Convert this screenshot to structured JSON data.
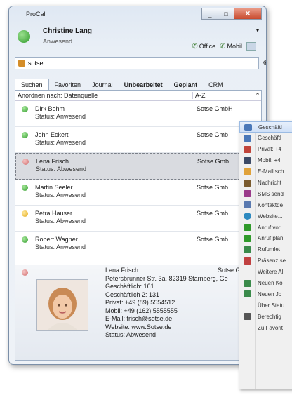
{
  "window": {
    "title": "ProCall",
    "controls": {
      "minimize": "_",
      "maximize": "□",
      "close": "✕"
    }
  },
  "user": {
    "name": "Christine Lang",
    "status": "Anwesend",
    "menu_glyph": "▾"
  },
  "modes": [
    {
      "label": "Office",
      "icon": "phone-icon"
    },
    {
      "label": "Mobil",
      "icon": "mobile-icon"
    }
  ],
  "search": {
    "value": "sotse",
    "button": "⊕"
  },
  "tabs": [
    {
      "label": "Suchen",
      "active": true
    },
    {
      "label": "Favoriten"
    },
    {
      "label": "Journal"
    },
    {
      "label": "Unbearbeitet",
      "bold": true
    },
    {
      "label": "Geplant",
      "bold": true
    },
    {
      "label": "CRM"
    }
  ],
  "sort": {
    "label": "Anordnen nach: Datenquelle",
    "value": "A-Z",
    "arrow": "⌃"
  },
  "contacts": [
    {
      "name": "Dirk Bohm",
      "status": "Status: Anwesend",
      "company": "Sotse GmbH",
      "dot": "green"
    },
    {
      "name": "John Eckert",
      "status": "Status: Anwesend",
      "company": "Sotse Gmb",
      "dot": "green"
    },
    {
      "name": "Lena Frisch",
      "status": "Status: Abwesend",
      "company": "Sotse Gmb",
      "dot": "pink",
      "selected": true
    },
    {
      "name": "Martin Seeler",
      "status": "Status: Anwesend",
      "company": "Sotse Gmb",
      "dot": "green"
    },
    {
      "name": "Petra Hauser",
      "status": "Status: Abwesend",
      "company": "Sotse Gmb",
      "dot": "yellow"
    },
    {
      "name": "Robert Wagner",
      "status": "Status: Anwesend",
      "company": "Sotse Gmb",
      "dot": "green"
    }
  ],
  "detail": {
    "name": "Lena Frisch",
    "company": "Sotse G",
    "lines": [
      "Petersbrunner Str. 3a, 82319 Starnberg, Ge",
      "Geschäftlich: 161",
      "Geschäftlich 2: 131",
      "Privat: +49 (89) 5554512",
      "Mobil: +49 (162) 5555555",
      "E-Mail: frisch@sotse.de",
      "Website: www.Sotse.de",
      "Status: Abwesend"
    ]
  },
  "context_menu": [
    {
      "label": "Geschäftl",
      "icon": "office-phone-icon",
      "color": "#4a78b8",
      "highlighted": true
    },
    {
      "label": "Geschäftl",
      "icon": "office-phone-icon",
      "color": "#4a78b8"
    },
    {
      "label": "Privat: +4",
      "icon": "home-icon",
      "color": "#c0443a"
    },
    {
      "label": "Mobil: +4",
      "icon": "mobile-icon",
      "color": "#3c4a66"
    },
    {
      "label": "E-Mail sch",
      "icon": "email-icon",
      "color": "#e0a23a"
    },
    {
      "label": "Nachricht",
      "icon": "message-icon",
      "color": "#7a5b2e"
    },
    {
      "label": "SMS send",
      "icon": "sms-icon",
      "color": "#9a3a8a"
    },
    {
      "label": "Kontaktde",
      "icon": "contact-card-icon",
      "color": "#5a7ab0"
    },
    {
      "label": "Website...",
      "icon": "globe-icon",
      "color": "#2e8ac0"
    },
    {
      "label": "Anruf vor",
      "icon": "call-schedule-icon",
      "color": "#2f9a2a"
    },
    {
      "label": "Anruf plan",
      "icon": "call-plan-icon",
      "color": "#2f9a2a"
    },
    {
      "label": "Rufumlet",
      "icon": "forward-icon",
      "color": "#3a8a4a"
    },
    {
      "label": "Präsenz se",
      "icon": "presence-icon",
      "color": "#c04040"
    },
    {
      "label": "Weitere Al",
      "icon": "",
      "color": ""
    },
    {
      "label": "Neuen Ko",
      "icon": "new-contact-icon",
      "color": "#3a8a4a"
    },
    {
      "label": "Neuen Jo",
      "icon": "new-journal-icon",
      "color": "#3a8a4a"
    },
    {
      "label": "Über Statu",
      "icon": "",
      "color": ""
    },
    {
      "label": "Berechtig",
      "icon": "permissions-icon",
      "color": "#555555"
    },
    {
      "label": "Zu Favorit",
      "icon": "",
      "color": ""
    }
  ]
}
